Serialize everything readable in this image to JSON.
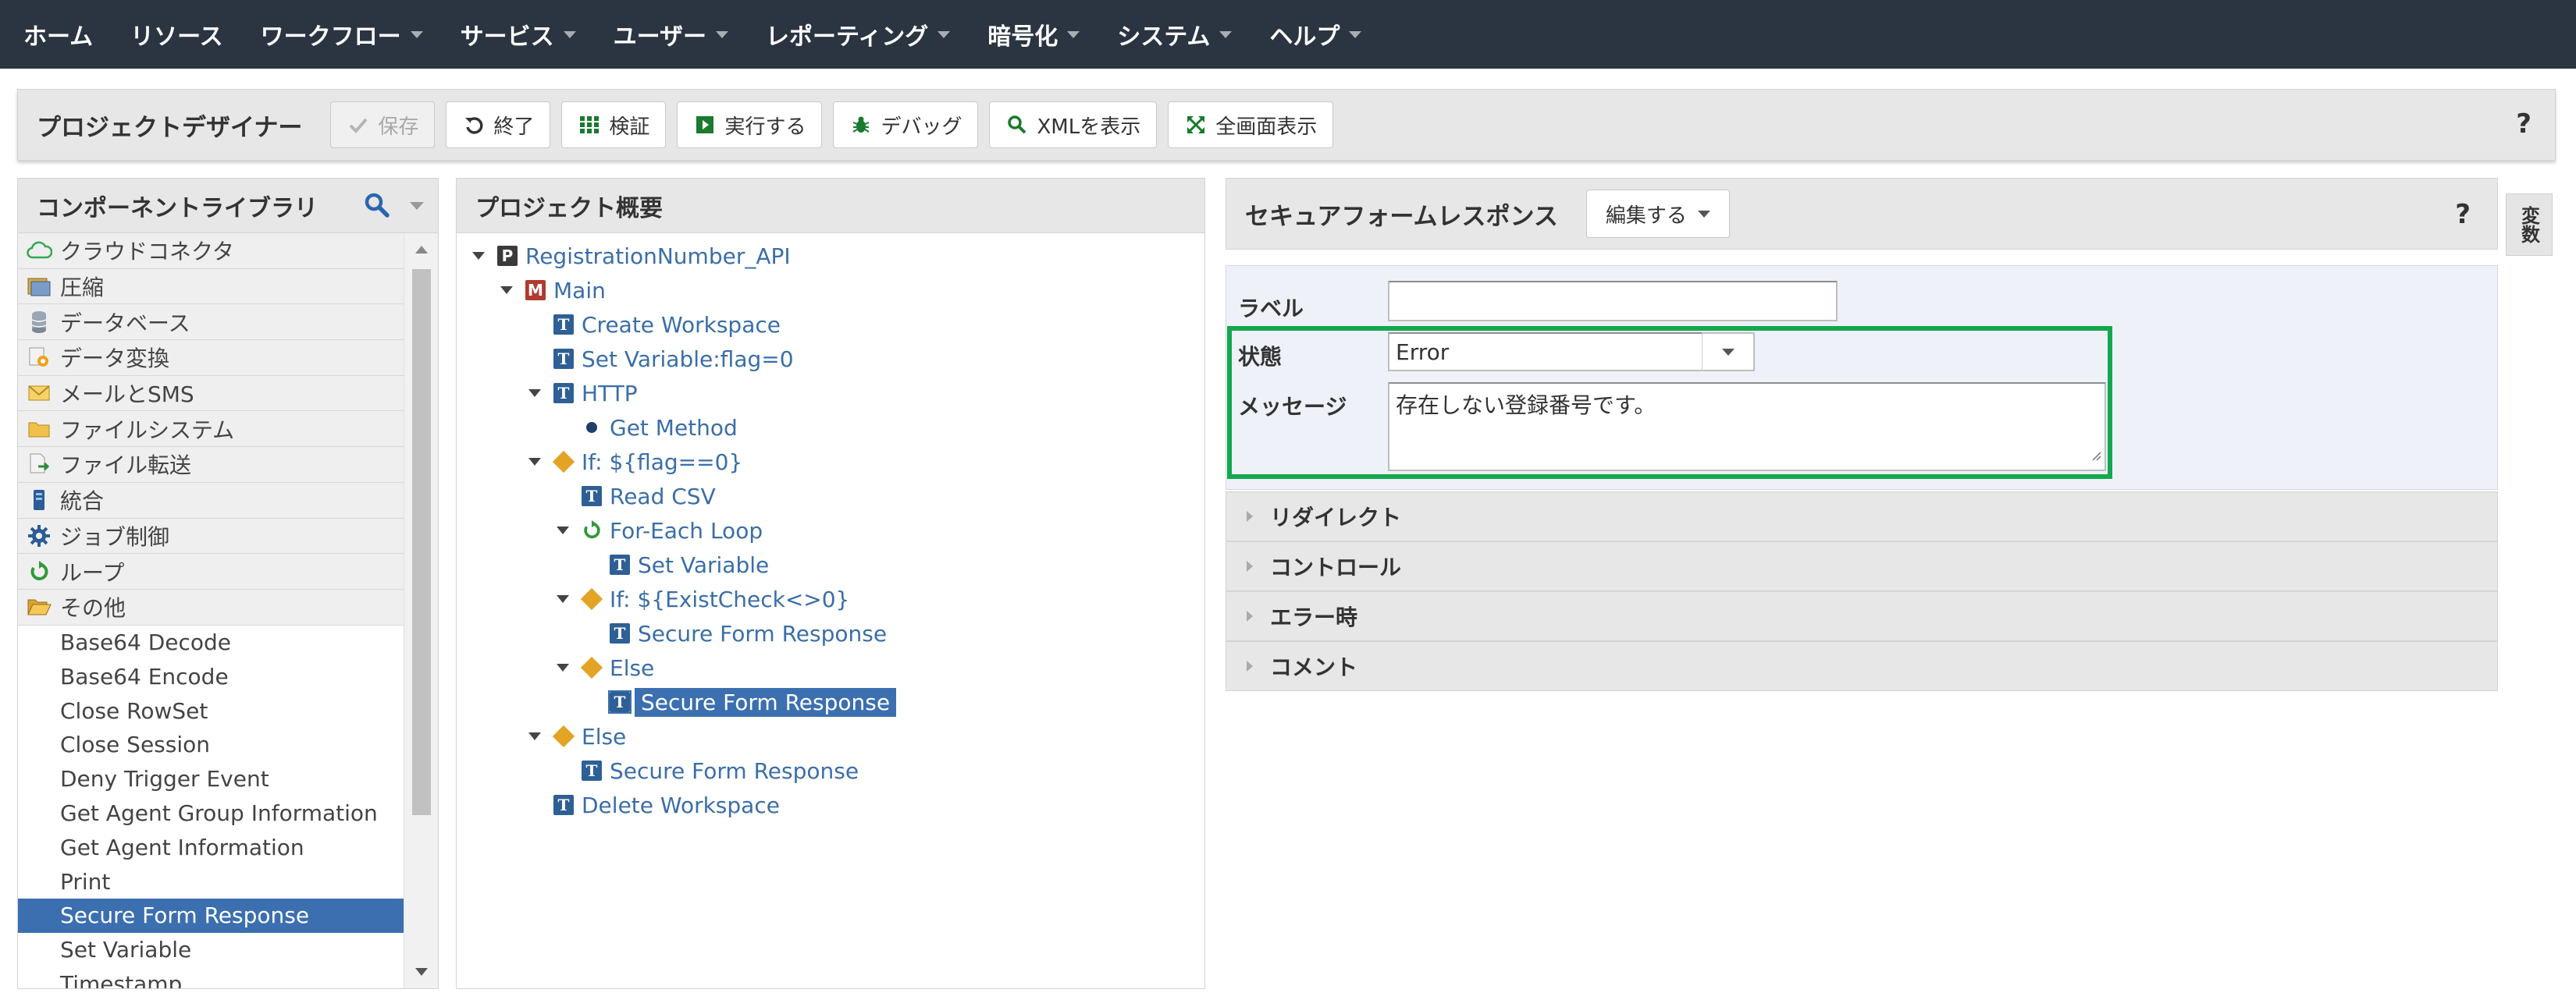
{
  "nav": {
    "items": [
      {
        "label": "ホーム",
        "has_menu": false
      },
      {
        "label": "リソース",
        "has_menu": false
      },
      {
        "label": "ワークフロー",
        "has_menu": true
      },
      {
        "label": "サービス",
        "has_menu": true
      },
      {
        "label": "ユーザー",
        "has_menu": true
      },
      {
        "label": "レポーティング",
        "has_menu": true
      },
      {
        "label": "暗号化",
        "has_menu": true
      },
      {
        "label": "システム",
        "has_menu": true
      },
      {
        "label": "ヘルプ",
        "has_menu": true
      }
    ]
  },
  "toolbar": {
    "title": "プロジェクトデザイナー",
    "save_label": "保存",
    "exit_label": "終了",
    "validate_label": "検証",
    "run_label": "実行する",
    "debug_label": "デバッグ",
    "xml_label": "XMLを表示",
    "fullscreen_label": "全画面表示",
    "help_label": "?"
  },
  "library": {
    "title": "コンポーネントライブラリ",
    "categories": [
      {
        "label": "クラウドコネクタ",
        "icon": "cloud-icon"
      },
      {
        "label": "圧縮",
        "icon": "compress-icon"
      },
      {
        "label": "データベース",
        "icon": "database-icon"
      },
      {
        "label": "データ変換",
        "icon": "data-transform-icon"
      },
      {
        "label": "メールとSMS",
        "icon": "mail-icon"
      },
      {
        "label": "ファイルシステム",
        "icon": "folder-icon"
      },
      {
        "label": "ファイル転送",
        "icon": "file-transfer-icon"
      },
      {
        "label": "統合",
        "icon": "integration-icon"
      },
      {
        "label": "ジョブ制御",
        "icon": "gear-icon"
      },
      {
        "label": "ループ",
        "icon": "loop-icon"
      },
      {
        "label": "その他",
        "icon": "open-folder-icon"
      }
    ],
    "items": [
      "Base64 Decode",
      "Base64 Encode",
      "Close RowSet",
      "Close Session",
      "Deny Trigger Event",
      "Get Agent Group Information",
      "Get Agent Information",
      "Print",
      "Secure Form Response",
      "Set Variable",
      "Timestamp"
    ],
    "selected_item": "Secure Form Response"
  },
  "project": {
    "title": "プロジェクト概要",
    "nodes": [
      {
        "label": "RegistrationNumber_API",
        "depth": 0,
        "expanded": true,
        "icon": "project-icon"
      },
      {
        "label": "Main",
        "depth": 1,
        "expanded": true,
        "icon": "module-icon"
      },
      {
        "label": "Create Workspace",
        "depth": 2,
        "expanded": null,
        "icon": "task-icon"
      },
      {
        "label": "Set Variable:flag=0",
        "depth": 2,
        "expanded": null,
        "icon": "task-icon"
      },
      {
        "label": "HTTP",
        "depth": 2,
        "expanded": true,
        "icon": "task-icon"
      },
      {
        "label": "Get Method",
        "depth": 3,
        "expanded": null,
        "icon": "bullet-icon"
      },
      {
        "label": "If: ${flag==0}",
        "depth": 2,
        "expanded": true,
        "icon": "condition-icon"
      },
      {
        "label": "Read CSV",
        "depth": 3,
        "expanded": null,
        "icon": "task-icon"
      },
      {
        "label": "For-Each Loop",
        "depth": 3,
        "expanded": true,
        "icon": "loop-icon"
      },
      {
        "label": "Set Variable",
        "depth": 4,
        "expanded": null,
        "icon": "task-icon"
      },
      {
        "label": "If: ${ExistCheck<>0}",
        "depth": 3,
        "expanded": true,
        "icon": "condition-icon"
      },
      {
        "label": "Secure Form Response",
        "depth": 4,
        "expanded": null,
        "icon": "task-icon"
      },
      {
        "label": "Else",
        "depth": 3,
        "expanded": true,
        "icon": "condition-icon"
      },
      {
        "label": "Secure Form Response",
        "depth": 4,
        "expanded": null,
        "icon": "task-icon",
        "selected": true
      },
      {
        "label": "Else",
        "depth": 2,
        "expanded": true,
        "icon": "condition-icon"
      },
      {
        "label": "Secure Form Response",
        "depth": 3,
        "expanded": null,
        "icon": "task-icon"
      },
      {
        "label": "Delete Workspace",
        "depth": 2,
        "expanded": null,
        "icon": "task-icon"
      }
    ]
  },
  "detail": {
    "title": "セキュアフォームレスポンス",
    "edit_label": "編集する",
    "help_label": "?",
    "vars_tab_label": "変数",
    "label_field": {
      "label": "ラベル",
      "value": ""
    },
    "status_field": {
      "label": "状態",
      "value": "Error"
    },
    "message_field": {
      "label": "メッセージ",
      "value": "存在しない登録番号です。"
    },
    "sections": [
      "リダイレクト",
      "コントロール",
      "エラー時",
      "コメント"
    ]
  },
  "colors": {
    "nav_bg": "#2b3441",
    "selection": "#3b6fb0",
    "link": "#3a6ea8",
    "highlight": "#14a84e"
  }
}
